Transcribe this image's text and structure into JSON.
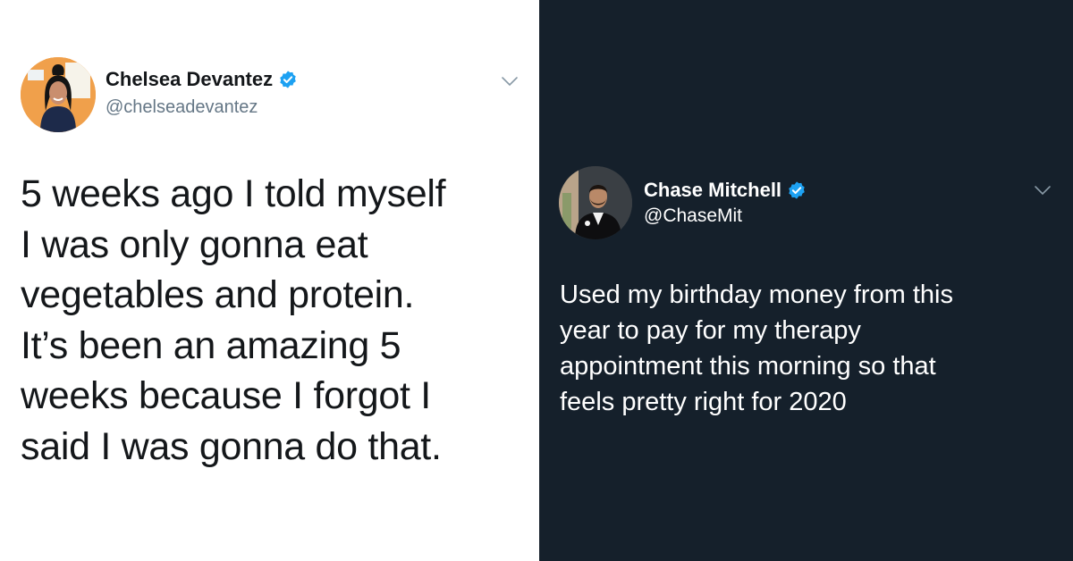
{
  "tweets": [
    {
      "display_name": "Chelsea Devantez",
      "handle": "@chelseadevantez",
      "verified": true,
      "text": "5 weeks ago I told myself\nI was only gonna eat\nvegetables and protein.\nIt’s been an amazing 5\nweeks because I forgot I\nsaid I was gonna do that.",
      "theme": "light",
      "avatar_icon": "avatar-photo",
      "menu_icon": "chevron-down-icon"
    },
    {
      "display_name": "Chase Mitchell",
      "handle": "@ChaseMit",
      "verified": true,
      "text": "Used my birthday money from this\nyear to pay for my therapy\nappointment this morning so that\nfeels pretty right for 2020",
      "theme": "dark",
      "avatar_icon": "avatar-photo",
      "menu_icon": "chevron-down-icon"
    }
  ],
  "colors": {
    "light_background": "#ffffff",
    "dark_background": "#15202b",
    "verified_badge": "#1da1f2",
    "light_text": "#14171a",
    "light_secondary_text": "#657786",
    "dark_text": "#ffffff",
    "avatar_left_background": "#f0a04b"
  }
}
